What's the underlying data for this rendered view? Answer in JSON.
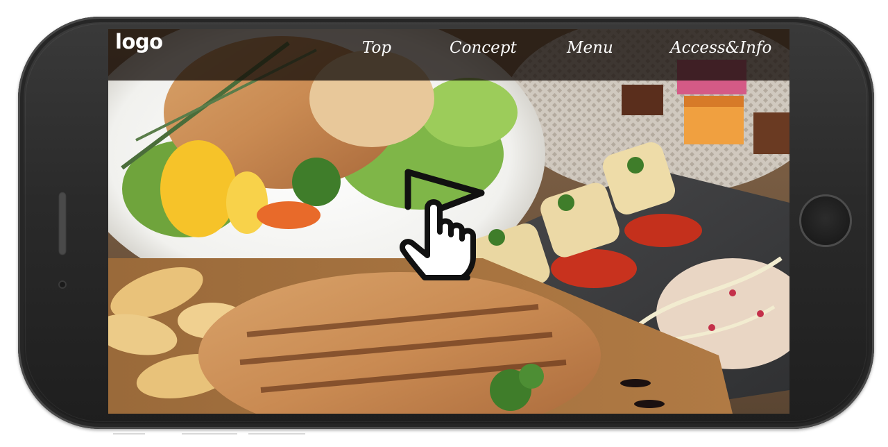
{
  "site": {
    "logo_text": "logo",
    "nav": [
      {
        "label": "Top"
      },
      {
        "label": "Concept"
      },
      {
        "label": "Menu"
      },
      {
        "label": "Access&Info"
      }
    ]
  },
  "hero": {
    "image": "food-platter-photo"
  },
  "gesture": {
    "icon": "tap-swipe-icon"
  },
  "colors": {
    "phone_body": "#2a2a2a",
    "nav_background": "#140e0a",
    "nav_text": "#ffffff"
  }
}
